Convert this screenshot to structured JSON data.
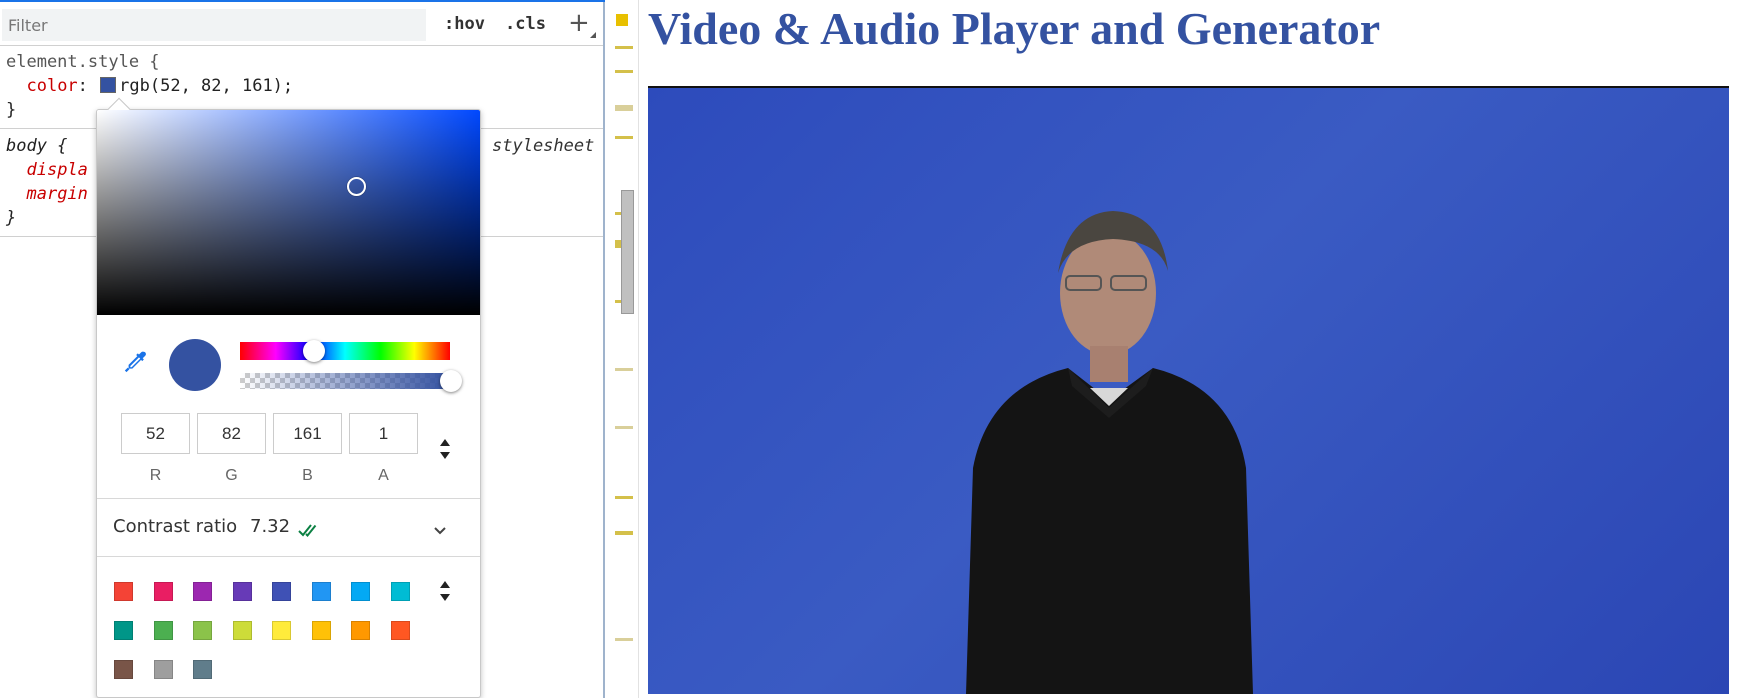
{
  "devtools": {
    "filter_placeholder": "Filter",
    "hov_label": ":hov",
    "cls_label": ".cls",
    "add_rule_label": "+",
    "element_style_rule": {
      "selector_line": "element.style {",
      "property": "color",
      "value": "rgb(52, 82, 161)",
      "close": "}"
    },
    "body_rule": {
      "selector_line": "body {",
      "source": "stylesheet",
      "display_fragment": "displa",
      "margin_fragment": "margin",
      "close": "}"
    }
  },
  "color_picker": {
    "current_color": "#3452a1",
    "rgba": {
      "r": "52",
      "g": "82",
      "b": "161",
      "a": "1"
    },
    "labels": {
      "r": "R",
      "g": "G",
      "b": "B",
      "a": "A"
    },
    "contrast_label": "Contrast ratio",
    "contrast_value": "7.32",
    "palette": [
      "#f44336",
      "#e91e63",
      "#9c27b0",
      "#673ab7",
      "#3f51b5",
      "#2196f3",
      "#03a9f4",
      "#00bcd4",
      "#009688",
      "#4caf50",
      "#8bc34a",
      "#cddc39",
      "#ffeb3b",
      "#ffc107",
      "#ff9800",
      "#ff5722",
      "#795548",
      "#9e9e9e",
      "#607d8b"
    ]
  },
  "page": {
    "title": "Video & Audio Player and Generator",
    "title_color": "#3452a1"
  },
  "icons": {
    "eyedropper": "eyedropper-icon",
    "contrast_check": "double-check-icon",
    "expand": "chevron-down-icon",
    "stepper": "up-down-stepper-icon"
  }
}
